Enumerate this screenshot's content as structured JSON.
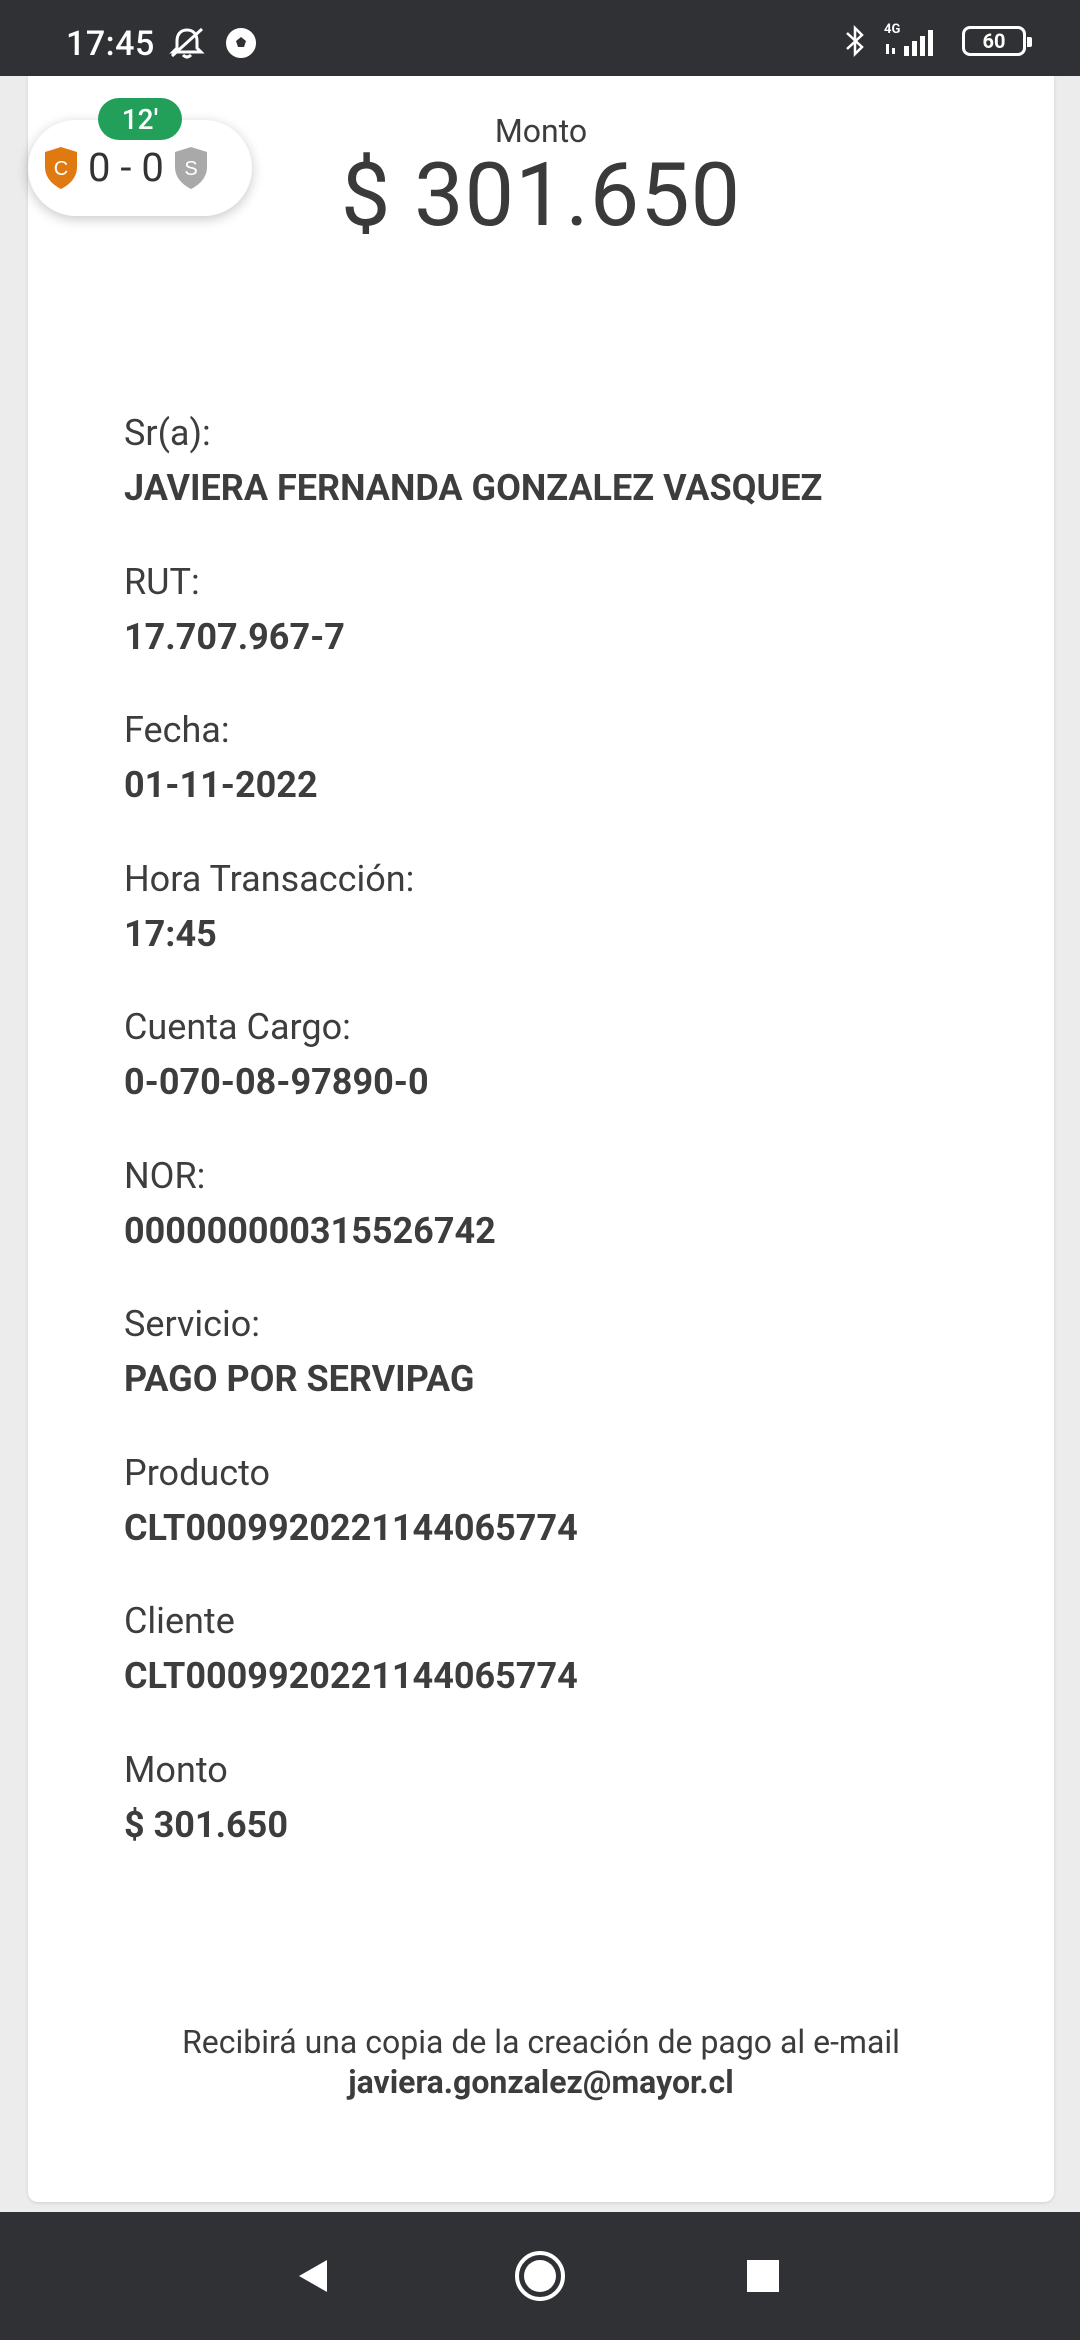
{
  "status_bar": {
    "time": "17:45",
    "network": "4G",
    "battery": "60"
  },
  "score_widget": {
    "minute": "12'",
    "home_initial": "C",
    "away_initial": "S",
    "score": "0 - 0",
    "home_color": "#e07a10",
    "away_color": "#a9a9a9"
  },
  "header": {
    "label": "Monto",
    "amount": "$ 301.650"
  },
  "details": [
    {
      "label": "Sr(a):",
      "value": "JAVIERA FERNANDA GONZALEZ VASQUEZ"
    },
    {
      "label": "RUT:",
      "value": "17.707.967-7"
    },
    {
      "label": "Fecha:",
      "value": "01-11-2022"
    },
    {
      "label": "Hora Transacción:",
      "value": "17:45"
    },
    {
      "label": "Cuenta Cargo:",
      "value": "0-070-08-97890-0"
    },
    {
      "label": "NOR:",
      "value": "000000000315526742"
    },
    {
      "label": "Servicio:",
      "value": "PAGO POR SERVIPAG"
    },
    {
      "label": "Producto",
      "value": "CLT0009920221144065774"
    },
    {
      "label": "Cliente",
      "value": "CLT0009920221144065774"
    },
    {
      "label": "Monto",
      "value": "$ 301.650"
    }
  ],
  "footer": {
    "message": "Recibirá una copia de la creación de pago al e-mail",
    "email": "javiera.gonzalez@mayor.cl"
  },
  "nav_bar": {
    "icons": [
      "back-icon",
      "home-icon",
      "recents-icon"
    ]
  }
}
